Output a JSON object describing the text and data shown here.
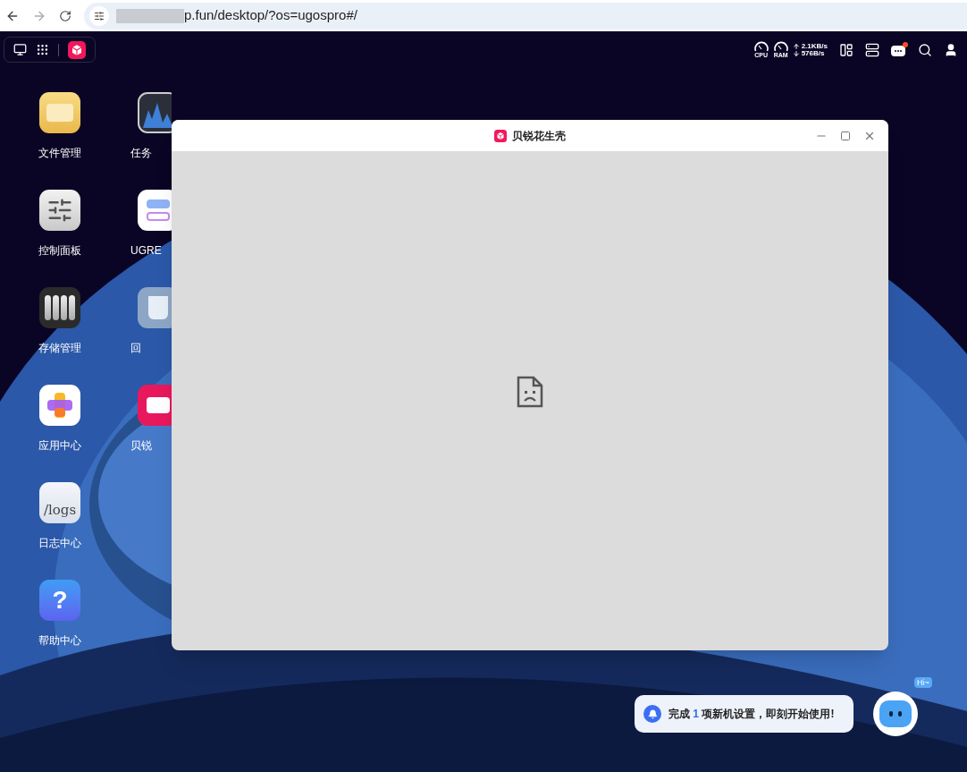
{
  "browser": {
    "url": "p.fun/desktop/?os=ugospro#/"
  },
  "tray": {
    "cpu_label": "CPU",
    "ram_label": "RAM",
    "upload": "2.1KB/s",
    "download": "576B/s",
    "unread": true
  },
  "desktop_icons_left": [
    {
      "kind": "folder",
      "label": "文件管理"
    },
    {
      "kind": "sliders",
      "label": "控制面板"
    },
    {
      "kind": "drives",
      "label": "存储管理"
    },
    {
      "kind": "apps",
      "label": "应用中心"
    },
    {
      "kind": "logs",
      "label": "日志中心",
      "icon_text": "/logs"
    },
    {
      "kind": "help",
      "label": "帮助中心",
      "icon_text": "?"
    }
  ],
  "desktop_icons_right": [
    {
      "kind": "monitor",
      "label": "任务"
    },
    {
      "kind": "ugreen",
      "label": "UGRE"
    },
    {
      "kind": "recycle",
      "label": "回"
    },
    {
      "kind": "pink",
      "label": "贝锐"
    }
  ],
  "window": {
    "title": "贝锐花生壳"
  },
  "notification": {
    "prefix": "完成",
    "count": "1",
    "suffix": "项新机设置，即刻开始使用!"
  },
  "assistant": {
    "badge": "Hi~"
  }
}
